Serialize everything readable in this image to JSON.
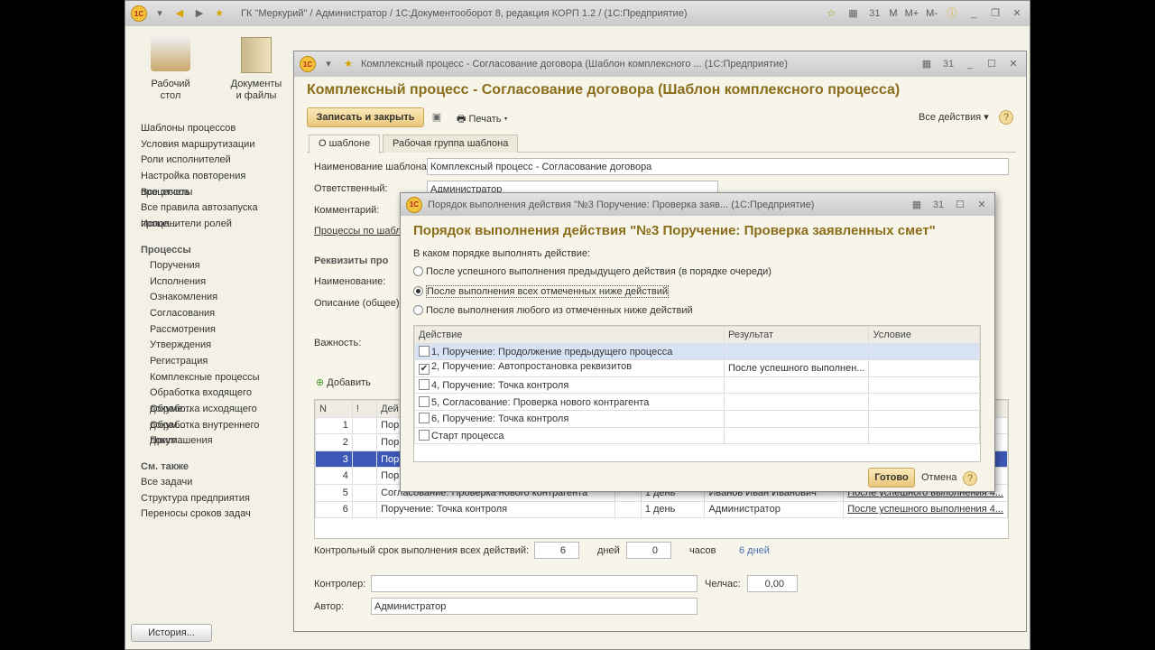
{
  "main_window": {
    "title": "ГК \"Меркурий\" / Администратор / 1С:Документооборот 8, редакция КОРП 1.2 / (1С:Предприятие)",
    "controls": [
      "M",
      "M+",
      "M-"
    ],
    "sections": [
      {
        "label": "Рабочий стол",
        "icon": "desk-lamp-icon"
      },
      {
        "label": "Документы и файлы",
        "icon": "document-folder-icon"
      }
    ],
    "sidebar": {
      "items": [
        "Шаблоны процессов",
        "Условия маршрутизации",
        "Роли исполнителей",
        "Настройка повторения процессов",
        "Все отчеты",
        "Все правила автозапуска проце...",
        "Исполнители ролей"
      ],
      "processes_title": "Процессы",
      "processes": [
        "Поручения",
        "Исполнения",
        "Ознакомления",
        "Согласования",
        "Рассмотрения",
        "Утверждения",
        "Регистрация",
        "Комплексные процессы",
        "Обработка входящего докуме...",
        "Обработка исходящего докум...",
        "Обработка внутреннего докум...",
        "Приглашения"
      ],
      "see_also_title": "См. также",
      "see_also": [
        "Все задачи",
        "Структура предприятия",
        "Переносы сроков задач"
      ]
    },
    "history_button": "История..."
  },
  "form": {
    "window_title": "Комплексный процесс - Согласование договора (Шаблон комплексного ... (1С:Предприятие)",
    "heading": "Комплексный процесс - Согласование договора (Шаблон комплексного процесса)",
    "save_close": "Записать и закрыть",
    "print": "Печать",
    "all_actions": "Все действия",
    "tabs": [
      "О шаблоне",
      "Рабочая группа шаблона"
    ],
    "name_label": "Наименование шаблона:",
    "name_value": "Комплексный процесс - Согласование договора",
    "responsible_label": "Ответственный:",
    "responsible_value": "Администратор",
    "comment_label": "Комментарий:",
    "processes_link": "Процессы по шабл",
    "requisites_title": "Реквизиты про",
    "naming_label": "Наименование:",
    "description_label": "Описание (общее):",
    "importance_label": "Важность:",
    "add_button": "Добавить",
    "table": {
      "headers": [
        "N",
        "!",
        "Дей"
      ],
      "rows": [
        {
          "n": "1",
          "action": "Пор"
        },
        {
          "n": "2",
          "action": "Пор"
        },
        {
          "n": "3",
          "action": "Пор",
          "selected": true
        },
        {
          "n": "4",
          "action": "Пор"
        },
        {
          "n": "5",
          "action": "Согласование: Проверка нового контрагента",
          "term": "1 день",
          "performer": "Иванов Иван Иванович",
          "order": "После успешного выполнения 4..."
        },
        {
          "n": "6",
          "action": "Поручение: Точка контроля",
          "term": "1 день",
          "performer": "Администратор",
          "order": "После успешного выполнения 4..."
        }
      ]
    },
    "deadline_label": "Контрольный срок выполнения всех действий:",
    "days_value": "6",
    "days_label": "дней",
    "hours_value": "0",
    "hours_label": "часов",
    "deadline_summary": "6 дней",
    "controller_label": "Контролер:",
    "controller_value": "",
    "manhours_label": "Челчас:",
    "manhours_value": "0,00",
    "author_label": "Автор:",
    "author_value": "Администратор"
  },
  "dialog": {
    "window_title": "Порядок выполнения действия \"№3 Поручение: Проверка заяв... (1С:Предприятие)",
    "heading": "Порядок выполнения действия \"№3 Поручение: Проверка заявленных смет\"",
    "question": "В каком порядке выполнять действие:",
    "options": [
      {
        "label": "После успешного выполнения предыдущего действия (в порядке очереди)",
        "selected": false
      },
      {
        "label": "После выполнения всех отмеченных ниже действий",
        "selected": true
      },
      {
        "label": "После выполнения любого из отмеченных ниже действий",
        "selected": false
      }
    ],
    "headers": [
      "Действие",
      "Результат",
      "Условие"
    ],
    "rows": [
      {
        "action": "1, Поручение: Продолжение предыдущего процесса",
        "checked": false,
        "result": "",
        "condition": ""
      },
      {
        "action": "2, Поручение: Автопростановка реквизитов",
        "checked": true,
        "result": "После успешного выполнен...",
        "condition": ""
      },
      {
        "action": "4, Поручение: Точка контроля",
        "checked": false,
        "result": "",
        "condition": ""
      },
      {
        "action": "5, Согласование: Проверка нового контрагента",
        "checked": false,
        "result": "",
        "condition": ""
      },
      {
        "action": "6, Поручение: Точка контроля",
        "checked": false,
        "result": "",
        "condition": ""
      },
      {
        "action": "Старт процесса",
        "checked": false,
        "result": "",
        "condition": ""
      }
    ],
    "ok": "Готово",
    "cancel": "Отмена"
  },
  "colors": {
    "heading": "#8a6d1a",
    "selection": "#3c58b7",
    "button": "#f0d38f"
  }
}
